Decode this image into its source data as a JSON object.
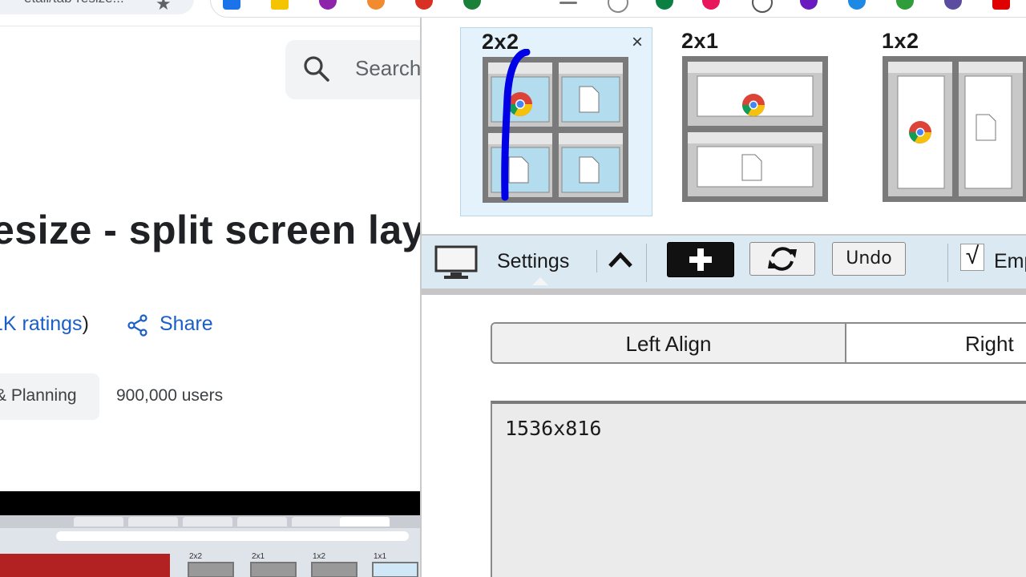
{
  "browser": {
    "url_fragment": "etail/tab-resize..."
  },
  "store_page": {
    "search_placeholder": "Search",
    "title": "esize - split screen lay",
    "ratings_text": "1K ratings",
    "ratings_paren_close": ")",
    "share_label": "Share",
    "category_label": "& Planning",
    "users_label": "900,000 users",
    "video_layout_labels": [
      "2x2",
      "2x1",
      "1x2",
      "1x1"
    ]
  },
  "popup": {
    "layouts": [
      {
        "label": "2x2",
        "selected": true
      },
      {
        "label": "2x1",
        "selected": false
      },
      {
        "label": "1x2",
        "selected": false
      }
    ],
    "close_symbol": "×",
    "settings_label": "Settings",
    "undo_label": "Undo",
    "empty_checkbox_mark": "√",
    "empty_label": "Emp",
    "align_left_label": "Left Align",
    "align_right_label": "Right",
    "resolution_text": "1536x816"
  },
  "colors": {
    "accent_blue": "#1a5ec8",
    "toolbar_bg": "#dbe9f3",
    "selected_card_bg": "#e4f2fb",
    "marker_blue": "#0000e6"
  }
}
